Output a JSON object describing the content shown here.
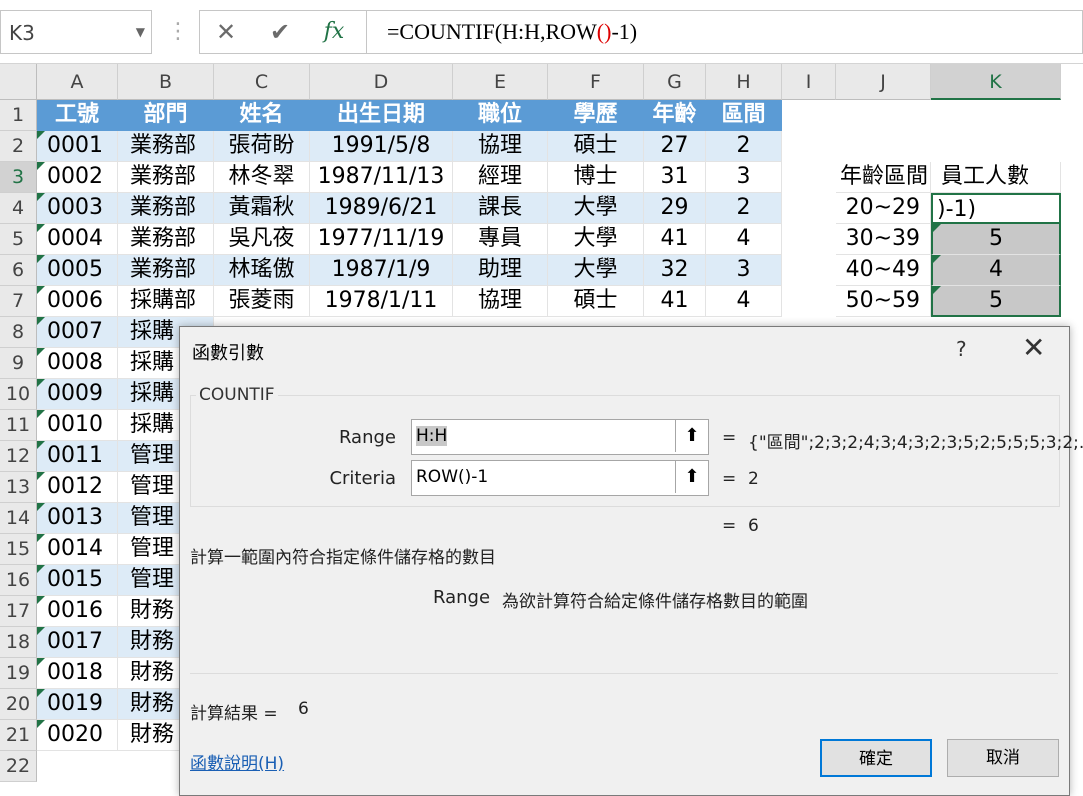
{
  "name_box": "K3",
  "formula_buttons": {
    "cancel": "✕",
    "enter": "✔",
    "insert_function": "fx"
  },
  "formula": {
    "pre": "=COUNTIF(H:H,ROW",
    "paren": "()",
    "post": "-1)"
  },
  "columns": [
    "A",
    "B",
    "C",
    "D",
    "E",
    "F",
    "G",
    "H",
    "I",
    "J",
    "K"
  ],
  "rows": [
    "1",
    "2",
    "3",
    "4",
    "5",
    "6",
    "7",
    "8",
    "9",
    "10",
    "11",
    "12",
    "13",
    "14",
    "15",
    "16",
    "17",
    "18",
    "19",
    "20",
    "21",
    "22"
  ],
  "table_header": [
    "工號",
    "部門",
    "姓名",
    "出生日期",
    "職位",
    "學歷",
    "年齡",
    "區間"
  ],
  "table_rows": [
    [
      "0001",
      "業務部",
      "張荷盼",
      "1991/5/8",
      "協理",
      "碩士",
      "27",
      "2"
    ],
    [
      "0002",
      "業務部",
      "林冬翠",
      "1987/11/13",
      "經理",
      "博士",
      "31",
      "3"
    ],
    [
      "0003",
      "業務部",
      "黃霜秋",
      "1989/6/21",
      "課長",
      "大學",
      "29",
      "2"
    ],
    [
      "0004",
      "業務部",
      "吳凡夜",
      "1977/11/19",
      "專員",
      "大學",
      "41",
      "4"
    ],
    [
      "0005",
      "業務部",
      "林瑤傲",
      "1987/1/9",
      "助理",
      "大學",
      "32",
      "3"
    ],
    [
      "0006",
      "採購部",
      "張菱雨",
      "1978/1/11",
      "協理",
      "碩士",
      "41",
      "4"
    ]
  ],
  "partial_rows": [
    [
      "0007",
      "採購"
    ],
    [
      "0008",
      "採購"
    ],
    [
      "0009",
      "採購"
    ],
    [
      "0010",
      "採購"
    ],
    [
      "0011",
      "管理"
    ],
    [
      "0012",
      "管理"
    ],
    [
      "0013",
      "管理"
    ],
    [
      "0014",
      "管理"
    ],
    [
      "0015",
      "管理"
    ],
    [
      "0016",
      "財務"
    ],
    [
      "0017",
      "財務"
    ],
    [
      "0018",
      "財務"
    ],
    [
      "0019",
      "財務"
    ],
    [
      "0020",
      "財務"
    ]
  ],
  "summary": {
    "header_j": "年齡區間",
    "header_k": "員工人數",
    "rows": [
      {
        "range": "20~29",
        "count": ")-1)"
      },
      {
        "range": "30~39",
        "count": "5"
      },
      {
        "range": "40~49",
        "count": "4"
      },
      {
        "range": "50~59",
        "count": "5"
      }
    ]
  },
  "dialog": {
    "title": "函數引數",
    "help": "?",
    "close": "✕",
    "function_name": "COUNTIF",
    "args": [
      {
        "label": "Range",
        "value": "H:H",
        "eq": "=",
        "result": "{\"區間\";2;3;2;4;3;4;3;2;3;5;2;5;5;5;3;2;..."
      },
      {
        "label": "Criteria",
        "value": "ROW()-1",
        "eq": "=",
        "result": "2"
      }
    ],
    "total_eq": "=",
    "total_result": "6",
    "description": "計算一範圍內符合指定條件儲存格的數目",
    "arg_desc_name": "Range",
    "arg_desc_text": "為欲計算符合給定條件儲存格數目的範圍",
    "calc_label": "計算結果 =",
    "calc_value": "6",
    "help_link": "函數說明(H)",
    "ok": "確定",
    "cancel": "取消"
  },
  "colors": {
    "header_blue": "#5b9bd5",
    "band_blue": "#ddebf7",
    "excel_green": "#217346"
  }
}
